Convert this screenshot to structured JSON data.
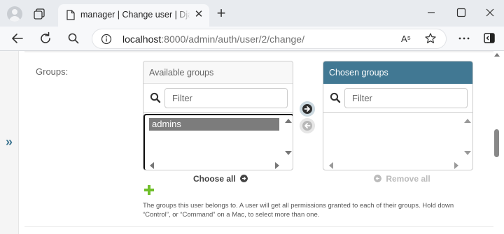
{
  "browser": {
    "tab_title": "manager | Change user | Django site admin",
    "tab_close": "✕",
    "new_tab": "+",
    "url_host": "localhost",
    "url_rest": ":8000/admin/auth/user/2/change/",
    "read_aloud": "A⁵",
    "more_label": "…"
  },
  "page": {
    "nav_toggle": "»",
    "groups_label": "Groups:",
    "available": {
      "title": "Available groups",
      "filter_placeholder": "Filter",
      "options": [
        "admins"
      ]
    },
    "chosen": {
      "title": "Chosen groups",
      "filter_placeholder": "Filter",
      "options": []
    },
    "choose_all": "Choose all",
    "remove_all": "Remove all",
    "help_text": "The groups this user belongs to. A user will get all permissions granted to each of their groups. Hold down “Control”, or “Command” on a Mac, to select more than one."
  },
  "colors": {
    "accent": "#417893",
    "add_green": "#70bf2b"
  },
  "icons": [
    "profile-icon",
    "tab-actions-icon",
    "document-icon",
    "back-icon",
    "reload-icon",
    "search-icon",
    "info-icon",
    "favorite-star-icon",
    "more-icon",
    "sidebar-icon",
    "filter-search-icon",
    "add-arrow-icon",
    "remove-arrow-icon",
    "add-plus-icon"
  ]
}
